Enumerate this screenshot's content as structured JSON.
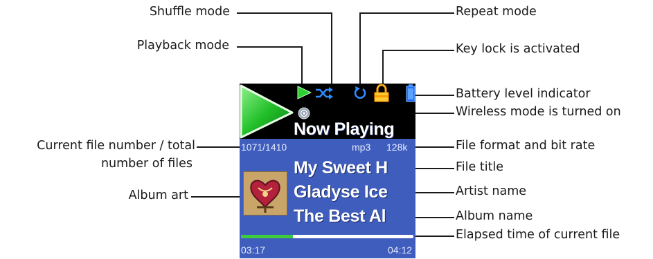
{
  "callouts": {
    "shuffle": "Shuffle mode",
    "playback": "Playback mode",
    "repeat": "Repeat mode",
    "keylock": "Key lock is activated",
    "battery": "Battery level indicator",
    "wireless": "Wireless mode is turned on",
    "file_number_line1": "Current file number / total",
    "file_number_line2": "number of files",
    "format": "File format and bit rate",
    "title": "File title",
    "album_art": "Album art",
    "artist": "Artist name",
    "album": "Album name",
    "elapsed": "Elapsed time of current file"
  },
  "screen": {
    "heading": "Now Playing",
    "file_counter": "1071/1410",
    "format": "mp3",
    "bitrate": "128k",
    "track_title": "My Sweet H",
    "artist": "Gladyse Ice",
    "album": "The Best Al",
    "elapsed_time": "03:17",
    "total_time": "04:12",
    "progress": 0.3
  },
  "icons": {
    "play": "play-icon",
    "playback_mode": "playback-mode-play-icon",
    "shuffle": "shuffle-icon",
    "repeat": "repeat-icon",
    "lock": "lock-icon",
    "battery": "battery-icon",
    "wireless": "wireless-icon",
    "album_art": "album-art-image"
  },
  "colors": {
    "screen_background": "#3f5dbd",
    "top_bar": "#000000",
    "play_green": "#22c02a",
    "progress_fill": "#3ecb3e",
    "text": "#ffffff"
  }
}
